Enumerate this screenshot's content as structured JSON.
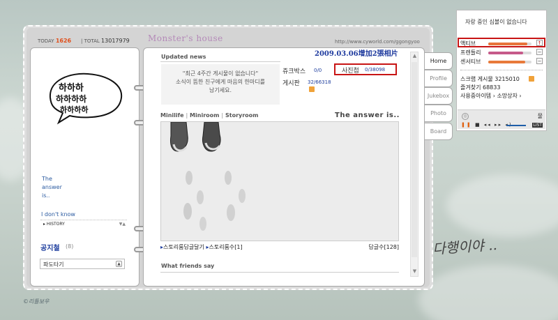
{
  "header": {
    "today_label": "TODAY",
    "today_count": "1626",
    "total_label": "TOTAL",
    "total_count": "13017979",
    "site_title": "Monster's house",
    "site_url": "http://www.cyworld.com/ggongyoo"
  },
  "left_page": {
    "answer_lines": [
      "The",
      "answer",
      "is.."
    ],
    "dont_know": "I don't know",
    "history": "HISTORY",
    "notice_title": "공지철",
    "notice_count": "(8)",
    "notice_select": "파도타기"
  },
  "main": {
    "updated_news": "Updated news",
    "news_message": [
      "\"최근 4주간 게시물이 없습니다\"",
      "소식이 뜸한 친구에게 마음의 한마디를",
      "남기세요."
    ],
    "annotation": "2009.03.06增加2張相片",
    "stats": {
      "jukebox_label": "쥬크박스",
      "jukebox_value": "0/0",
      "photo_label": "사진첩",
      "photo_value": "0/38098",
      "board_label": "게시판",
      "board_value": "32/66318"
    },
    "menu": [
      "Minilife",
      "Miniroom",
      "Storyroom"
    ],
    "answer_title": "The answer is..",
    "story_link1": "스토리룸답글달기",
    "story_link2": "스토리룸수[1]",
    "reply_count": "답글수[128]",
    "friends_say": "What friends say"
  },
  "tabs": [
    "Home",
    "Profile",
    "Jukebox",
    "Photo",
    "Board"
  ],
  "widget": {
    "message": "자랑 중인 심볼이 없습니다",
    "rows": [
      {
        "label": "액티브",
        "level": 0.9,
        "color": "#e8743a"
      },
      {
        "label": "프렌들리",
        "level": 0.8,
        "color": "#c65a8a"
      },
      {
        "label": "센서티브",
        "level": 0.85,
        "color": "#e87a3a"
      }
    ],
    "scrap": "스크랩 게시물 3215010",
    "favorites": "즐겨찾기 68833",
    "items": "사용중아이템 › 소망상자 ›",
    "track": "물",
    "lst": "LIST"
  },
  "handwriting": "다행이야 ..",
  "copyright": "©리틀보우"
}
